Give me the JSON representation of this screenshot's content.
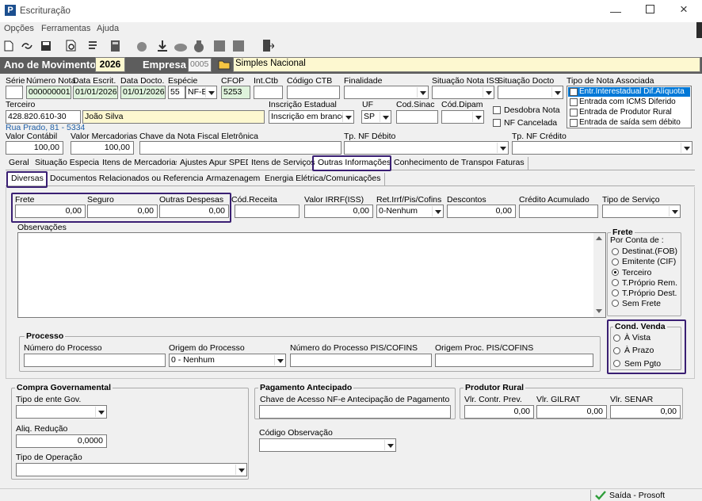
{
  "window": {
    "title": "Escrituração"
  },
  "menu": [
    "Opções",
    "Ferramentas",
    "Ajuda"
  ],
  "header": {
    "ano_label": "Ano de Movimento",
    "ano_value": "2026",
    "empresa_label": "Empresa",
    "empresa_code": "0005",
    "empresa_name": "Simples Nacional"
  },
  "row1": {
    "serie_label": "Série",
    "serie_value": "",
    "numero_label": "Número Nota",
    "numero_value": "000000001",
    "data_escrit_label": "Data Escrit.",
    "data_escrit_value": "01/01/2026",
    "data_docto_label": "Data Docto.",
    "data_docto_value": "01/01/2026",
    "especie_label": "Espécie",
    "especie_code": "55",
    "especie_value": "NF-E",
    "cfop_label": "CFOP",
    "cfop_value": "5253",
    "intctb_label": "Int.Ctb",
    "codctb_label": "Código CTB",
    "finalidade_label": "Finalidade",
    "sit_iss_label": "Situação Nota ISS",
    "sit_docto_label": "Situação Docto",
    "tipo_nota_label": "Tipo de Nota Associada"
  },
  "tipo_nota_items": [
    "Entr.Interestadual Dif.Alíquota",
    "Entrada com ICMS Diferido",
    "Entrada de Produtor Rural",
    "Entrada de saída sem débito"
  ],
  "row2": {
    "terceiro_label": "Terceiro",
    "terceiro_code": "428.820.610-30",
    "terceiro_name": "João Silva",
    "endereco": "Rua Prado, 81 - 5334",
    "ie_label": "Inscrição Estadual",
    "ie_value": "Inscrição em branco",
    "uf_label": "UF",
    "uf_value": "SP",
    "codsinac_label": "Cod.Sinac",
    "coddipam_label": "Cód.Dipam",
    "desdobra_label": "Desdobra Nota",
    "cancelada_label": "NF Cancelada"
  },
  "row3": {
    "valor_contabil_label": "Valor Contábil",
    "valor_contabil_value": "100,00",
    "valor_merc_label": "Valor Mercadorias",
    "valor_merc_value": "100,00",
    "chave_label": "Chave da Nota Fiscal Eletrônica",
    "tp_debito_label": "Tp. NF Débito",
    "tp_credito_label": "Tp. NF Crédito"
  },
  "tabs": [
    "Geral",
    "Situação Especial",
    "Itens de Mercadorias",
    "Ajustes Apur SPED",
    "Itens de Serviços",
    "Outras Informações",
    "Conhecimento de Transporte",
    "Faturas"
  ],
  "subtabs": [
    "Diversas",
    "Documentos Relacionados ou Referenciados",
    "Armazenagem",
    "Energia Elétrica/Comunicações"
  ],
  "diversas": {
    "frete_label": "Frete",
    "frete_value": "0,00",
    "seguro_label": "Seguro",
    "seguro_value": "0,00",
    "outras_label": "Outras Despesas",
    "outras_value": "0,00",
    "codreceita_label": "Cód.Receita",
    "irrf_label": "Valor IRRF(ISS)",
    "irrf_value": "0,00",
    "ret_label": "Ret.Irrf/Pis/Cofins",
    "ret_value": "0-Nenhum",
    "descontos_label": "Descontos",
    "descontos_value": "0,00",
    "credito_label": "Crédito Acumulado",
    "tipo_servico_label": "Tipo de Serviço",
    "obs_label": "Observações"
  },
  "frete_group": {
    "title": "Frete",
    "subtitle": "Por Conta de :",
    "options": [
      "Destinat.(FOB)",
      "Emitente (CIF)",
      "Terceiro",
      "T.Próprio Rem.",
      "T.Próprio Dest.",
      "Sem Frete"
    ],
    "selected": 2
  },
  "cond_venda": {
    "title": "Cond. Venda",
    "options": [
      "À Vista",
      "À Prazo",
      "Sem Pgto"
    ]
  },
  "processo": {
    "title": "Processo",
    "numero_label": "Número do Processo",
    "origem_label": "Origem do Processo",
    "origem_value": "0 - Nenhum",
    "numero_pis_label": "Número do Processo PIS/COFINS",
    "origem_pis_label": "Origem Proc. PIS/COFINS"
  },
  "compra": {
    "title": "Compra Governamental",
    "tipo_ente_label": "Tipo de ente Gov.",
    "aliq_label": "Aliq. Redução",
    "aliq_value": "0,0000",
    "tipo_op_label": "Tipo de Operação"
  },
  "pagamento": {
    "title": "Pagamento Antecipado",
    "chave_label": "Chave de Acesso NF-e Antecipação de Pagamento",
    "cod_obs_label": "Código Observação"
  },
  "produtor": {
    "title": "Produtor Rural",
    "contr_label": "Vlr. Contr. Prev.",
    "contr_value": "0,00",
    "gilrat_label": "Vlr. GILRAT",
    "gilrat_value": "0,00",
    "senar_label": "Vlr. SENAR",
    "senar_value": "0,00"
  },
  "status": {
    "text": "Saída - Prosoft"
  },
  "colors": {
    "header_bar": "#5d5d5d",
    "highlight": "#3a1f73",
    "app_icon": "#1c4f8f"
  }
}
